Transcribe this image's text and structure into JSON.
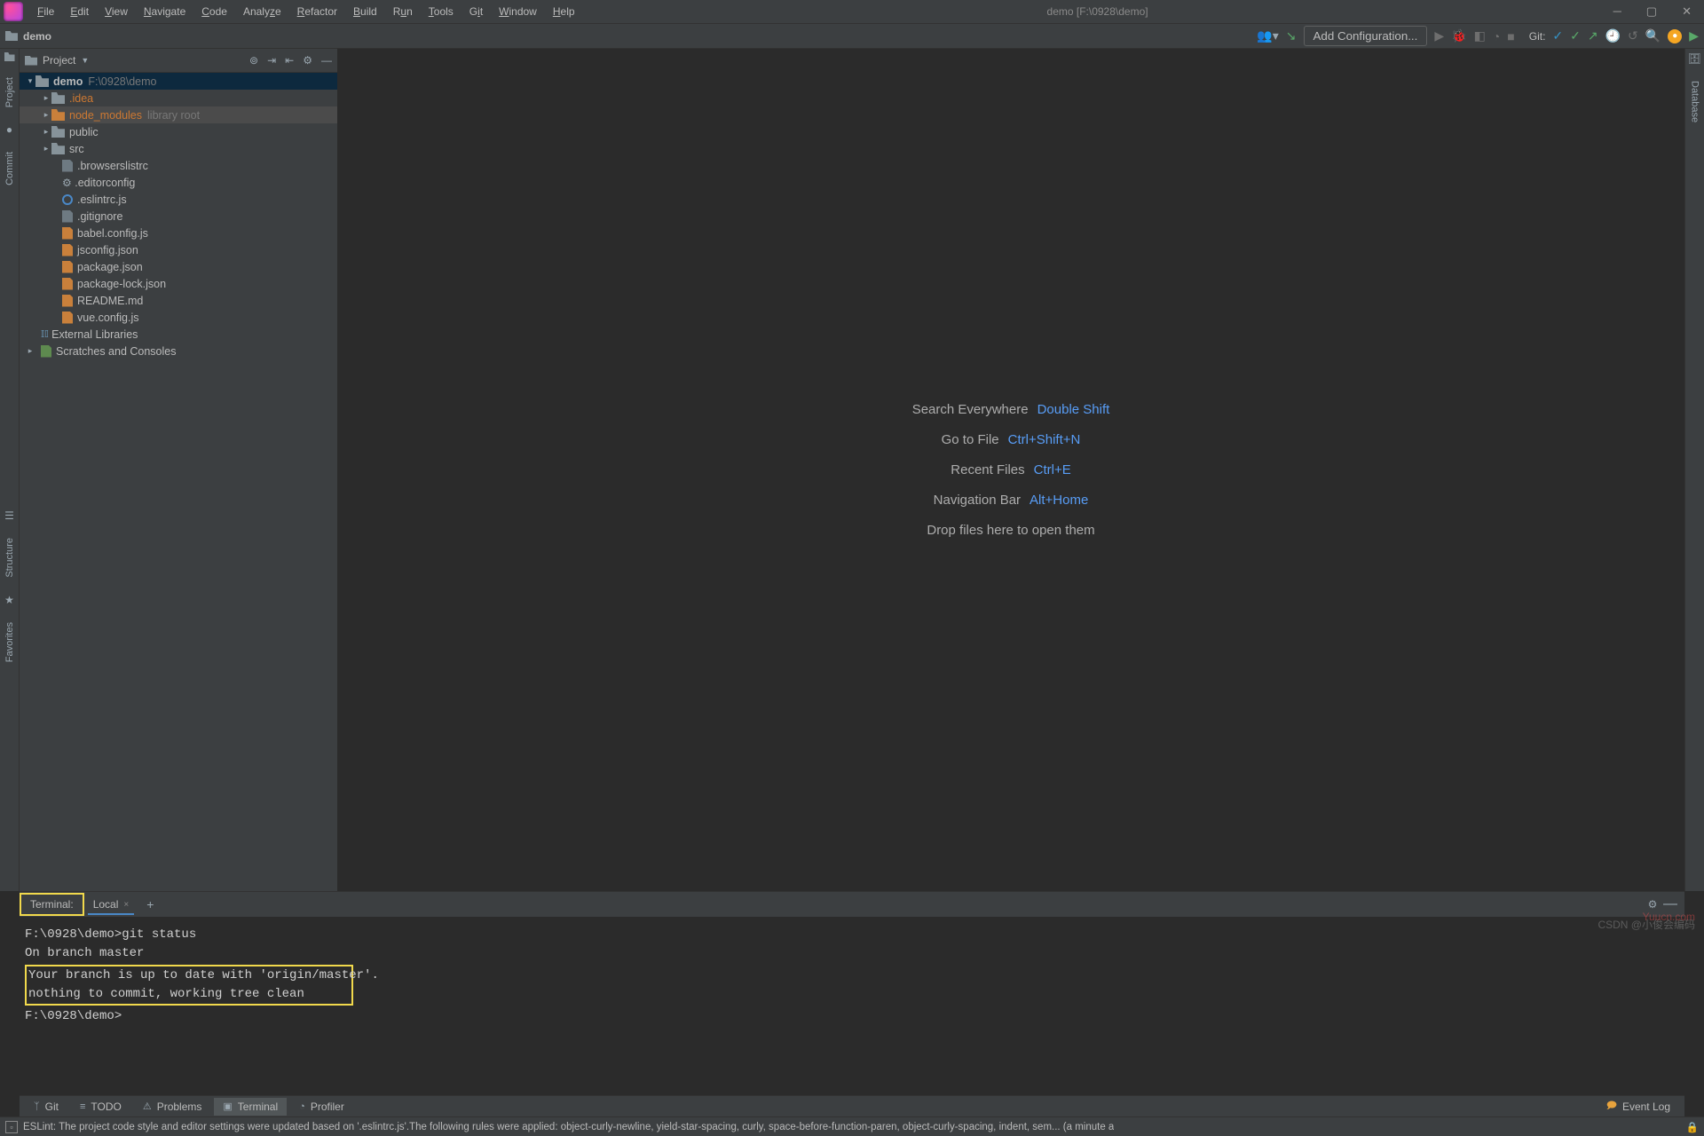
{
  "window_title": "demo [F:\\0928\\demo]",
  "menus": [
    "File",
    "Edit",
    "View",
    "Navigate",
    "Code",
    "Analyze",
    "Refactor",
    "Build",
    "Run",
    "Tools",
    "Git",
    "Window",
    "Help"
  ],
  "breadcrumb": "demo",
  "config_btn": "Add Configuration...",
  "git_label": "Git:",
  "left_tabs": {
    "project": "Project",
    "commit": "Commit"
  },
  "right_tabs": {
    "database": "Database"
  },
  "left_tabs2": {
    "structure": "Structure",
    "favorites": "Favorites"
  },
  "pp_header": "Project",
  "tree": {
    "root": {
      "name": "demo",
      "path": "F:\\0928\\demo"
    },
    "idea": ".idea",
    "node_modules": {
      "name": "node_modules",
      "hint": "library root"
    },
    "public": "public",
    "src": "src",
    "files": [
      ".browserslistrc",
      ".editorconfig",
      ".eslintrc.js",
      ".gitignore",
      "babel.config.js",
      "jsconfig.json",
      "package.json",
      "package-lock.json",
      "README.md",
      "vue.config.js"
    ],
    "ext_lib": "External Libraries",
    "scratches": "Scratches and Consoles"
  },
  "welcome": {
    "r1": {
      "label": "Search Everywhere",
      "sc": "Double Shift"
    },
    "r2": {
      "label": "Go to File",
      "sc": "Ctrl+Shift+N"
    },
    "r3": {
      "label": "Recent Files",
      "sc": "Ctrl+E"
    },
    "r4": {
      "label": "Navigation Bar",
      "sc": "Alt+Home"
    },
    "r5": "Drop files here to open them"
  },
  "term": {
    "label": "Terminal:",
    "tab": "Local",
    "lines": {
      "l1": "F:\\0928\\demo>git status",
      "l2": "On branch master",
      "l3": "Your branch is up to date with 'origin/master'.",
      "l4": "",
      "l5": "nothing to commit, working tree clean",
      "l6": "",
      "l7": "F:\\0928\\demo>"
    }
  },
  "btabs": {
    "git": "Git",
    "todo": "TODO",
    "problems": "Problems",
    "terminal": "Terminal",
    "profiler": "Profiler"
  },
  "status": {
    "msg": "ESLint: The project code style and editor settings were updated based on '.eslintrc.js'.The following rules were applied: object-curly-newline, yield-star-spacing, curly, space-before-function-paren, object-curly-spacing, indent, sem... (a minute a",
    "event": "Event Log"
  },
  "watermark": "CSDN @小俊会编码",
  "watermark2": "Yuucn.com"
}
